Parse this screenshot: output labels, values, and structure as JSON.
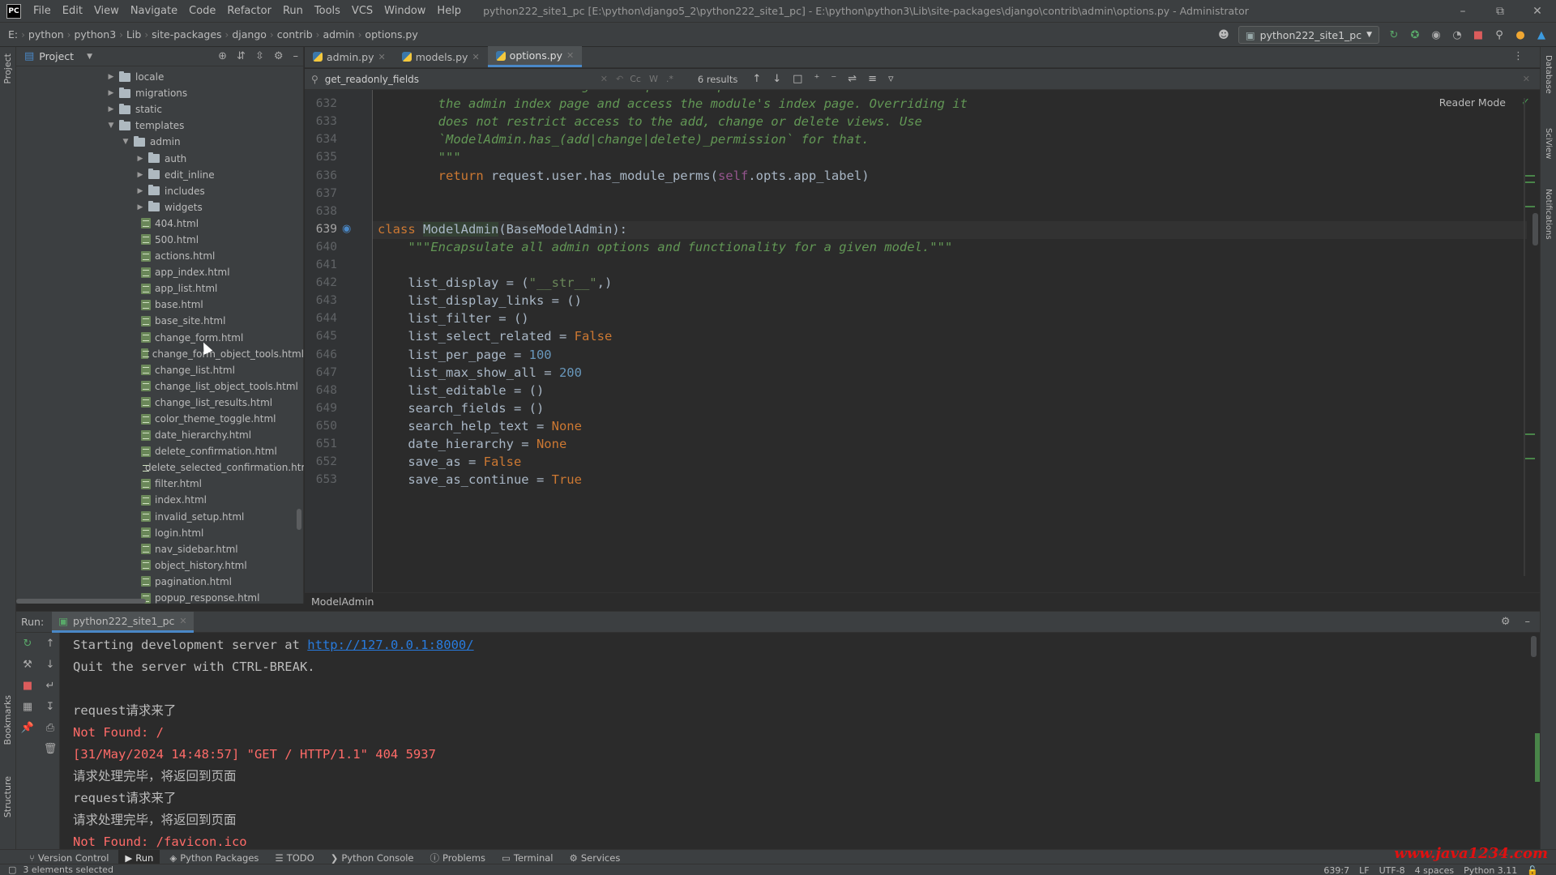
{
  "menubar": {
    "app_logo": "PC",
    "items": [
      "File",
      "Edit",
      "View",
      "Navigate",
      "Code",
      "Refactor",
      "Run",
      "Tools",
      "VCS",
      "Window",
      "Help"
    ],
    "title": "python222_site1_pc [E:\\python\\django5_2\\python222_site1_pc] - E:\\python\\python3\\Lib\\site-packages\\django\\contrib\\admin\\options.py - Administrator"
  },
  "breadcrumb": [
    "E:",
    "python",
    "python3",
    "Lib",
    "site-packages",
    "django",
    "contrib",
    "admin",
    "options.py"
  ],
  "run_config": "python222_site1_pc",
  "project_panel": {
    "title": "Project",
    "tree": [
      {
        "label": "locale",
        "type": "folder",
        "depth": 0,
        "expanded": false
      },
      {
        "label": "migrations",
        "type": "folder",
        "depth": 0,
        "expanded": false
      },
      {
        "label": "static",
        "type": "folder",
        "depth": 0,
        "expanded": false
      },
      {
        "label": "templates",
        "type": "folder",
        "depth": 0,
        "expanded": true
      },
      {
        "label": "admin",
        "type": "folder",
        "depth": 1,
        "expanded": true
      },
      {
        "label": "auth",
        "type": "folder",
        "depth": 2,
        "expanded": false
      },
      {
        "label": "edit_inline",
        "type": "folder",
        "depth": 2,
        "expanded": false
      },
      {
        "label": "includes",
        "type": "folder",
        "depth": 2,
        "expanded": false
      },
      {
        "label": "widgets",
        "type": "folder",
        "depth": 2,
        "expanded": false
      },
      {
        "label": "404.html",
        "type": "file",
        "depth": 2
      },
      {
        "label": "500.html",
        "type": "file",
        "depth": 2
      },
      {
        "label": "actions.html",
        "type": "file",
        "depth": 2
      },
      {
        "label": "app_index.html",
        "type": "file",
        "depth": 2
      },
      {
        "label": "app_list.html",
        "type": "file",
        "depth": 2
      },
      {
        "label": "base.html",
        "type": "file",
        "depth": 2
      },
      {
        "label": "base_site.html",
        "type": "file",
        "depth": 2
      },
      {
        "label": "change_form.html",
        "type": "file",
        "depth": 2
      },
      {
        "label": "change_form_object_tools.html",
        "type": "file",
        "depth": 2
      },
      {
        "label": "change_list.html",
        "type": "file",
        "depth": 2
      },
      {
        "label": "change_list_object_tools.html",
        "type": "file",
        "depth": 2
      },
      {
        "label": "change_list_results.html",
        "type": "file",
        "depth": 2
      },
      {
        "label": "color_theme_toggle.html",
        "type": "file",
        "depth": 2
      },
      {
        "label": "date_hierarchy.html",
        "type": "file",
        "depth": 2
      },
      {
        "label": "delete_confirmation.html",
        "type": "file",
        "depth": 2
      },
      {
        "label": "delete_selected_confirmation.html",
        "type": "file",
        "depth": 2
      },
      {
        "label": "filter.html",
        "type": "file",
        "depth": 2
      },
      {
        "label": "index.html",
        "type": "file",
        "depth": 2
      },
      {
        "label": "invalid_setup.html",
        "type": "file",
        "depth": 2
      },
      {
        "label": "login.html",
        "type": "file",
        "depth": 2
      },
      {
        "label": "nav_sidebar.html",
        "type": "file",
        "depth": 2
      },
      {
        "label": "object_history.html",
        "type": "file",
        "depth": 2
      },
      {
        "label": "pagination.html",
        "type": "file",
        "depth": 2
      },
      {
        "label": "popup_response.html",
        "type": "file",
        "depth": 2
      }
    ]
  },
  "tabs": [
    {
      "label": "admin.py",
      "active": false
    },
    {
      "label": "models.py",
      "active": false
    },
    {
      "label": "options.py",
      "active": true
    }
  ],
  "find": {
    "query": "get_readonly_fields",
    "opt_case": "Cc",
    "opt_word": "W",
    "results": "6 results"
  },
  "editor": {
    "reader_mode": "Reader Mode",
    "current_line": "639",
    "lines": [
      {
        "n": "631",
        "html": "        <span class=\"doc\">Return True if the given request has permission to view the module on</span>"
      },
      {
        "n": "632",
        "html": "        <span class=\"doc\">the admin index page and access the module's index page. Overriding it</span>"
      },
      {
        "n": "633",
        "html": "        <span class=\"doc\">does not restrict access to the add, change or delete views. Use</span>"
      },
      {
        "n": "634",
        "html": "        <span class=\"doc\">`ModelAdmin.has_(add|change|delete)_permission` for that.</span>"
      },
      {
        "n": "635",
        "html": "        <span class=\"doc\">\"\"\"</span>"
      },
      {
        "n": "636",
        "html": "        <span class=\"kw\">return</span> request.user.has_module_perms(<span class=\"self\">self</span>.opts.app_label)"
      },
      {
        "n": "637",
        "html": ""
      },
      {
        "n": "638",
        "html": ""
      },
      {
        "n": "639",
        "html": "<span class=\"kw\">class</span> <span class=\"clsname\">ModelAdmin</span>(BaseModelAdmin):"
      },
      {
        "n": "640",
        "html": "    <span class=\"doc\">\"\"\"Encapsulate all admin options and functionality for a given model.\"\"\"</span>"
      },
      {
        "n": "641",
        "html": ""
      },
      {
        "n": "642",
        "html": "    list_display = (<span class=\"str\">\"__str__\"</span>,)"
      },
      {
        "n": "643",
        "html": "    list_display_links = ()"
      },
      {
        "n": "644",
        "html": "    list_filter = ()"
      },
      {
        "n": "645",
        "html": "    list_select_related = <span class=\"kw\">False</span>"
      },
      {
        "n": "646",
        "html": "    list_per_page = <span class=\"num\">100</span>"
      },
      {
        "n": "647",
        "html": "    list_max_show_all = <span class=\"num\">200</span>"
      },
      {
        "n": "648",
        "html": "    list_editable = ()"
      },
      {
        "n": "649",
        "html": "    search_fields = ()"
      },
      {
        "n": "650",
        "html": "    search_help_text = <span class=\"kw\">None</span>"
      },
      {
        "n": "651",
        "html": "    date_hierarchy = <span class=\"kw\">None</span>"
      },
      {
        "n": "652",
        "html": "    save_as = <span class=\"kw\">False</span>"
      },
      {
        "n": "653",
        "html": "    save_as_continue = <span class=\"kw\">True</span>"
      }
    ],
    "crumb": "ModelAdmin"
  },
  "run_panel": {
    "label": "Run:",
    "tab": "python222_site1_pc",
    "console": [
      {
        "text": "Starting development server at ",
        "link": "http://127.0.0.1:8000/",
        "err": false
      },
      {
        "text": "Quit the server with CTRL-BREAK.",
        "err": false
      },
      {
        "text": "",
        "err": false
      },
      {
        "text": "request请求来了",
        "err": false
      },
      {
        "text": "Not Found: /",
        "err": true
      },
      {
        "text": "[31/May/2024 14:48:57] \"GET / HTTP/1.1\" 404 5937",
        "err": true
      },
      {
        "text": "请求处理完毕，将返回到页面",
        "err": false
      },
      {
        "text": "request请求来了",
        "err": false
      },
      {
        "text": "请求处理完毕，将返回到页面",
        "err": false
      },
      {
        "text": "Not Found: /favicon.ico",
        "err": true
      }
    ]
  },
  "tool_windows": [
    {
      "label": "Version Control",
      "icon": "branch-icon"
    },
    {
      "label": "Run",
      "icon": "play-icon",
      "active": true
    },
    {
      "label": "Python Packages",
      "icon": "package-icon"
    },
    {
      "label": "TODO",
      "icon": "list-icon"
    },
    {
      "label": "Python Console",
      "icon": "console-icon"
    },
    {
      "label": "Problems",
      "icon": "info-icon"
    },
    {
      "label": "Terminal",
      "icon": "terminal-icon"
    },
    {
      "label": "Services",
      "icon": "services-icon"
    }
  ],
  "left_stripe": {
    "project": "Project",
    "bookmarks": "Bookmarks",
    "structure": "Structure"
  },
  "right_stripe": {
    "database": "Database",
    "sciview": "SciView",
    "notifications": "Notifications"
  },
  "status": {
    "left": "3 elements selected",
    "position": "639:7",
    "line_sep": "LF",
    "encoding": "UTF-8",
    "indent": "4 spaces",
    "interpreter": "Python 3.11"
  },
  "watermark": "www.java1234.com"
}
